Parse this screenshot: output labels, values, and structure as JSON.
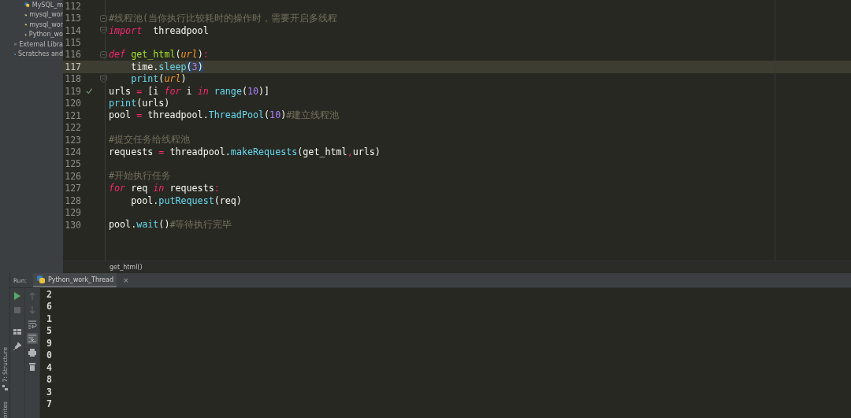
{
  "project_tree": {
    "items": [
      {
        "kind": "python",
        "label": "MySQL_m"
      },
      {
        "kind": "python",
        "label": "mysql_wor"
      },
      {
        "kind": "python",
        "label": "mysql_wor"
      },
      {
        "kind": "python",
        "label": "Python_wo"
      },
      {
        "kind": "library",
        "label": "External Libra"
      },
      {
        "kind": "scratch",
        "label": "Scratches and"
      }
    ]
  },
  "editor": {
    "lines": [
      {
        "number": "112",
        "current": false,
        "check": false,
        "fold_start": false,
        "fold_end": false
      },
      {
        "number": "113",
        "current": false,
        "check": false,
        "fold_start": true,
        "fold_end": false,
        "tokens": [
          {
            "kind": "comment",
            "text": "#线程池(当你执行比较耗时的操作时，需要开启多线程"
          }
        ]
      },
      {
        "number": "114",
        "current": false,
        "check": false,
        "fold_start": false,
        "fold_end": true,
        "tokens": [
          {
            "kind": "keyword",
            "text": "import"
          },
          {
            "kind": "plain",
            "text": "  threadpool"
          }
        ]
      },
      {
        "number": "115",
        "current": false,
        "check": false,
        "fold_start": false,
        "fold_end": false
      },
      {
        "number": "116",
        "current": false,
        "check": false,
        "fold_start": true,
        "fold_end": false,
        "tokens": [
          {
            "kind": "keyword",
            "text": "def"
          },
          {
            "kind": "defname",
            "text": " get_html"
          },
          {
            "kind": "plain",
            "text": "("
          },
          {
            "kind": "param",
            "text": "url"
          },
          {
            "kind": "plain",
            "text": ")"
          },
          {
            "kind": "op",
            "text": ":"
          }
        ]
      },
      {
        "number": "117",
        "current": true,
        "check": false,
        "fold_start": false,
        "fold_end": false,
        "tokens": [
          {
            "kind": "plain",
            "text": "    time."
          },
          {
            "kind": "call",
            "text": "sleep"
          },
          {
            "kind": "brace",
            "text": "("
          },
          {
            "kind": "number",
            "text": "3"
          },
          {
            "kind": "brace",
            "text": ")"
          }
        ]
      },
      {
        "number": "118",
        "current": false,
        "check": false,
        "fold_start": false,
        "fold_end": true,
        "tokens": [
          {
            "kind": "call",
            "text": "    print"
          },
          {
            "kind": "plain",
            "text": "("
          },
          {
            "kind": "param",
            "text": "url"
          },
          {
            "kind": "plain",
            "text": ")"
          }
        ]
      },
      {
        "number": "119",
        "current": false,
        "check": true,
        "fold_start": false,
        "fold_end": false,
        "tokens": [
          {
            "kind": "plain",
            "text": "urls "
          },
          {
            "kind": "op",
            "text": "="
          },
          {
            "kind": "plain",
            "text": " [i "
          },
          {
            "kind": "keyword",
            "text": "for"
          },
          {
            "kind": "plain",
            "text": " i "
          },
          {
            "kind": "keyword",
            "text": "in"
          },
          {
            "kind": "call",
            "text": " range"
          },
          {
            "kind": "plain",
            "text": "("
          },
          {
            "kind": "number",
            "text": "10"
          },
          {
            "kind": "plain",
            "text": ")]"
          }
        ]
      },
      {
        "number": "120",
        "current": false,
        "check": false,
        "fold_start": false,
        "fold_end": false,
        "tokens": [
          {
            "kind": "call",
            "text": "print"
          },
          {
            "kind": "plain",
            "text": "(urls)"
          }
        ]
      },
      {
        "number": "121",
        "current": false,
        "check": false,
        "fold_start": false,
        "fold_end": false,
        "tokens": [
          {
            "kind": "plain",
            "text": "pool "
          },
          {
            "kind": "op",
            "text": "="
          },
          {
            "kind": "plain",
            "text": " threadpool."
          },
          {
            "kind": "call",
            "text": "ThreadPool"
          },
          {
            "kind": "plain",
            "text": "("
          },
          {
            "kind": "number",
            "text": "10"
          },
          {
            "kind": "plain",
            "text": ")"
          },
          {
            "kind": "comment",
            "text": "#建立线程池"
          }
        ]
      },
      {
        "number": "122",
        "current": false,
        "check": false,
        "fold_start": false,
        "fold_end": false
      },
      {
        "number": "123",
        "current": false,
        "check": false,
        "fold_start": false,
        "fold_end": false,
        "tokens": [
          {
            "kind": "comment",
            "text": "#提交任务给线程池"
          }
        ]
      },
      {
        "number": "124",
        "current": false,
        "check": false,
        "fold_start": false,
        "fold_end": false,
        "tokens": [
          {
            "kind": "plain",
            "text": "requests "
          },
          {
            "kind": "op",
            "text": "="
          },
          {
            "kind": "plain",
            "text": " threadpool."
          },
          {
            "kind": "call",
            "text": "makeRequests"
          },
          {
            "kind": "plain",
            "text": "(get_html"
          },
          {
            "kind": "op",
            "text": ","
          },
          {
            "kind": "plain",
            "text": "urls)"
          }
        ]
      },
      {
        "number": "125",
        "current": false,
        "check": false,
        "fold_start": false,
        "fold_end": false
      },
      {
        "number": "126",
        "current": false,
        "check": false,
        "fold_start": false,
        "fold_end": false,
        "tokens": [
          {
            "kind": "comment",
            "text": "#开始执行任务"
          }
        ]
      },
      {
        "number": "127",
        "current": false,
        "check": false,
        "fold_start": false,
        "fold_end": false,
        "tokens": [
          {
            "kind": "keyword",
            "text": "for"
          },
          {
            "kind": "plain",
            "text": " req "
          },
          {
            "kind": "keyword",
            "text": "in"
          },
          {
            "kind": "plain",
            "text": " requests"
          },
          {
            "kind": "op",
            "text": ":"
          }
        ]
      },
      {
        "number": "128",
        "current": false,
        "check": false,
        "fold_start": false,
        "fold_end": false,
        "tokens": [
          {
            "kind": "plain",
            "text": "    pool."
          },
          {
            "kind": "call",
            "text": "putRequest"
          },
          {
            "kind": "plain",
            "text": "(req)"
          }
        ]
      },
      {
        "number": "129",
        "current": false,
        "check": false,
        "fold_start": false,
        "fold_end": false
      },
      {
        "number": "130",
        "current": false,
        "check": false,
        "fold_start": false,
        "fold_end": false,
        "tokens": [
          {
            "kind": "plain",
            "text": "pool."
          },
          {
            "kind": "call",
            "text": "wait"
          },
          {
            "kind": "plain",
            "text": "()"
          },
          {
            "kind": "comment",
            "text": "#等待执行完毕"
          }
        ]
      }
    ],
    "breadcrumb": "get_html()"
  },
  "tool_strip": {
    "items": [
      {
        "kind": "structure",
        "label": "7: Structure"
      },
      {
        "kind": "favorites",
        "label": "orites"
      }
    ]
  },
  "run_window": {
    "label": "Run:",
    "tabs": [
      {
        "label": "Python_work_Thread",
        "selected": true,
        "close": "×"
      }
    ],
    "toolbar_left": [
      {
        "kind": "run",
        "disabled": false
      },
      {
        "kind": "stop",
        "disabled": true
      },
      {
        "kind": "layout",
        "disabled": false
      },
      {
        "kind": "pin",
        "disabled": false
      }
    ],
    "toolbar_right": [
      {
        "kind": "up",
        "disabled": true,
        "on": false
      },
      {
        "kind": "down",
        "disabled": true,
        "on": false
      },
      {
        "kind": "wrap",
        "disabled": false,
        "on": false
      },
      {
        "kind": "scroll-end",
        "disabled": false,
        "on": true
      },
      {
        "kind": "print",
        "disabled": false,
        "on": false
      },
      {
        "kind": "trash",
        "disabled": false,
        "on": false
      }
    ],
    "output": [
      "2",
      "6",
      "1",
      "5",
      "9",
      "0",
      "4",
      "8",
      "3",
      "7"
    ]
  }
}
